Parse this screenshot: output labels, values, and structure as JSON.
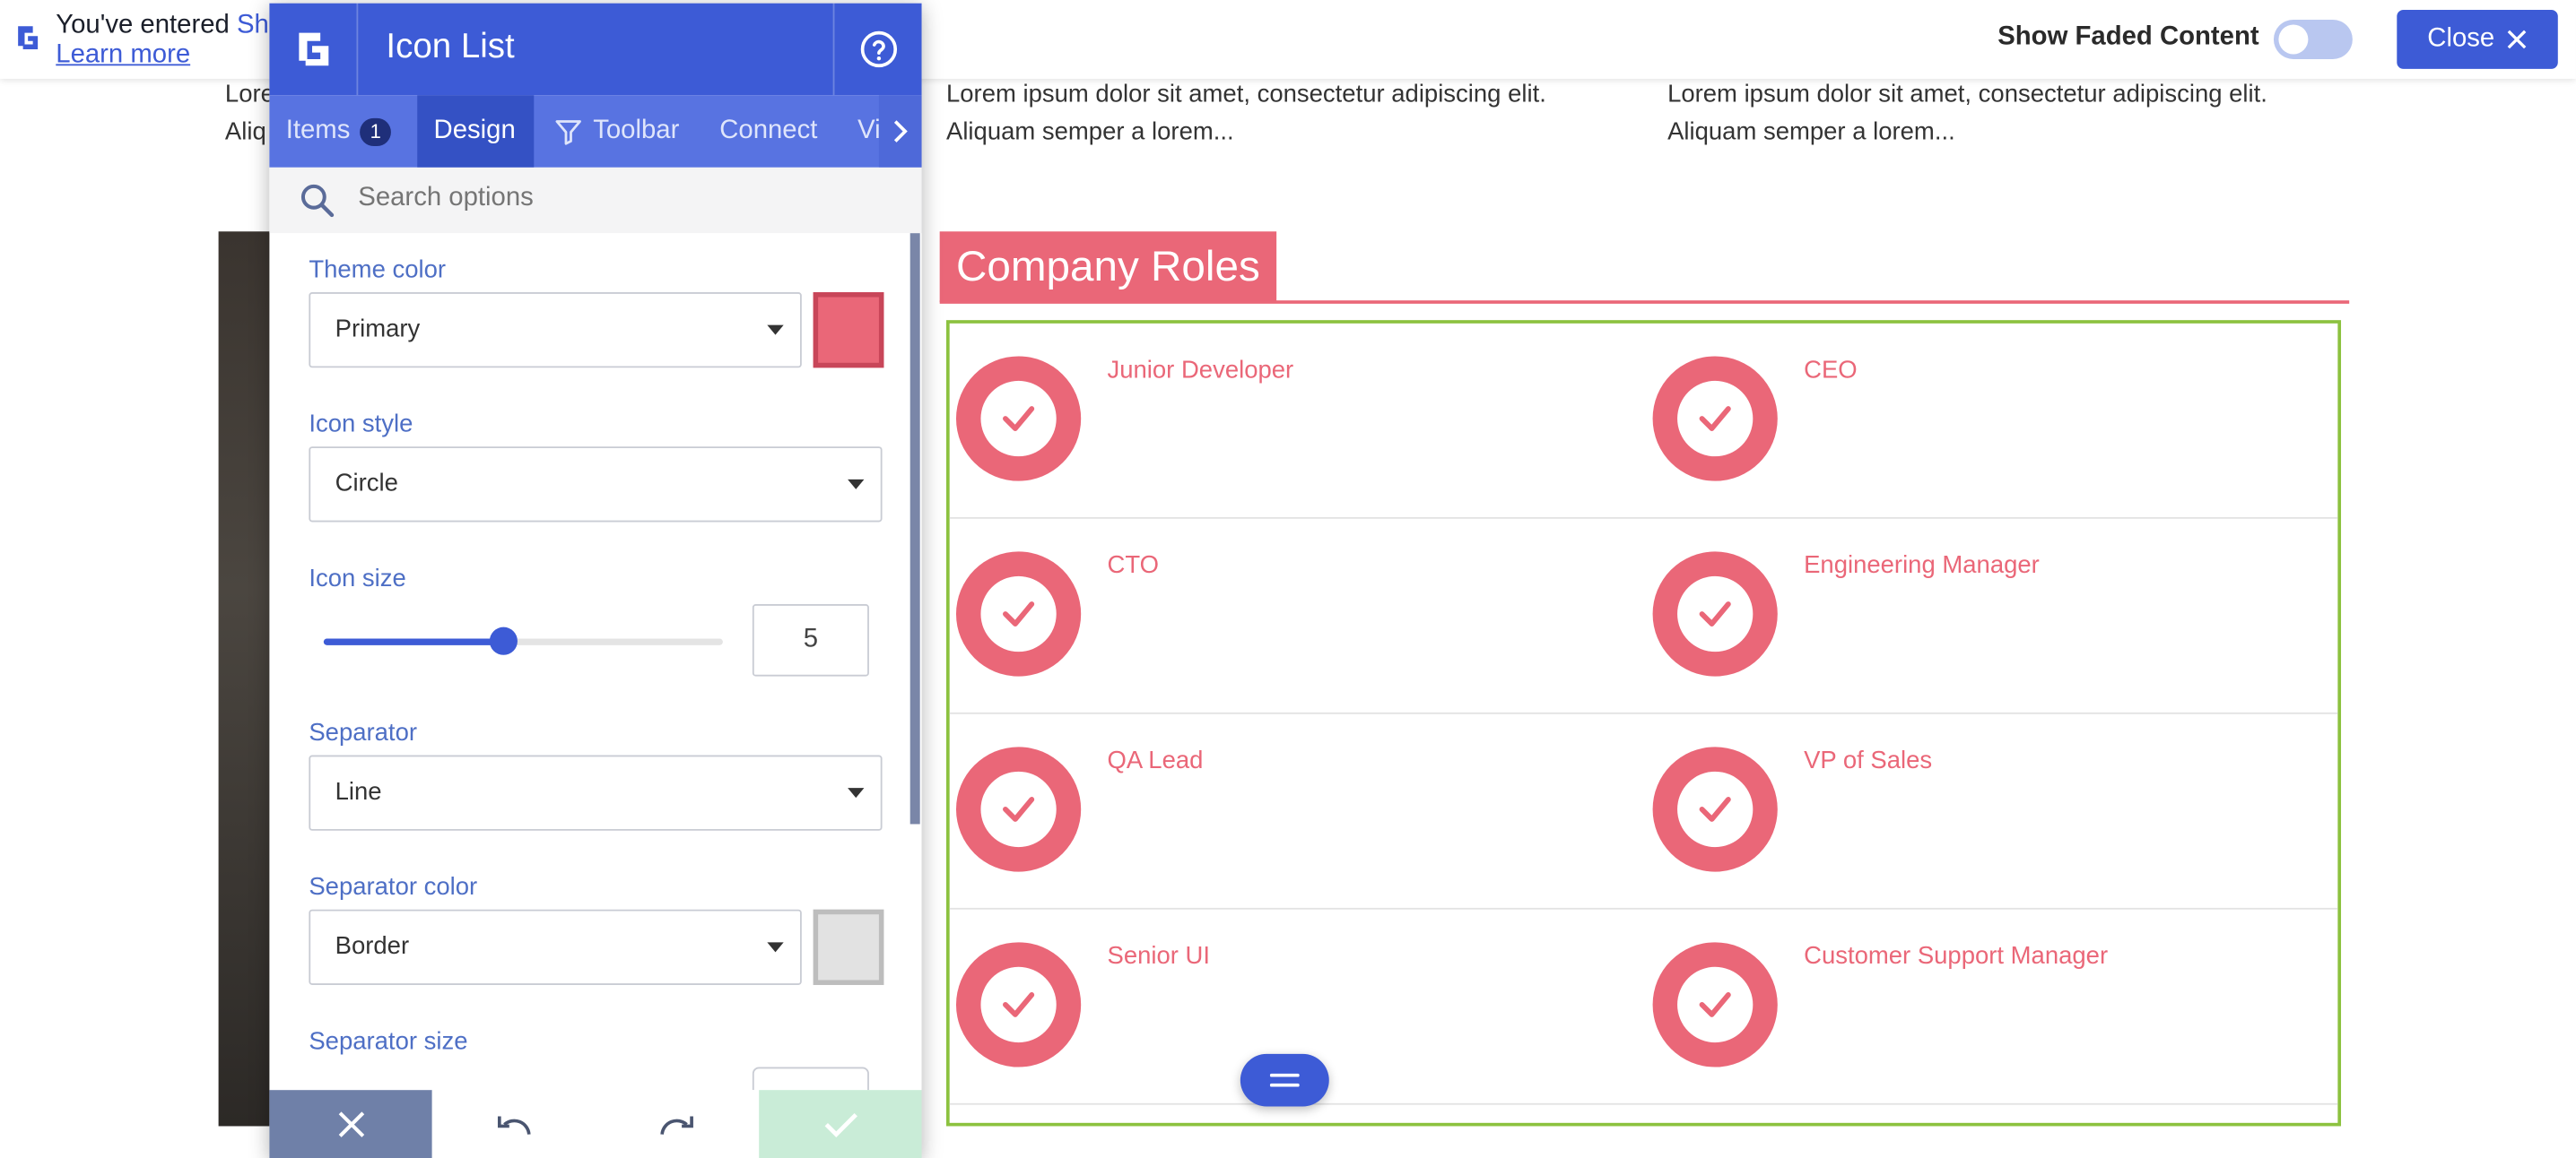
{
  "topbar": {
    "message_prefix": "You've entered ",
    "message_highlight": "Sh",
    "learn_more": "Learn more",
    "faded_label": "Show Faded Content",
    "faded_on": false,
    "close_label": "Close"
  },
  "page": {
    "left_snippet_line1": "Lore",
    "left_snippet_line2": "Aliq",
    "col2_line1": "Lorem ipsum dolor sit amet, consectetur adipiscing elit.",
    "col2_line2": "Aliquam semper a lorem...",
    "col3_line1": "Lorem ipsum dolor sit amet, consectetur adipiscing elit.",
    "col3_line2": "Aliquam semper a lorem...",
    "roles_heading": "Company Roles",
    "roles": [
      [
        "Junior Developer",
        "CEO"
      ],
      [
        "CTO",
        "Engineering Manager"
      ],
      [
        "QA Lead",
        "VP of Sales"
      ],
      [
        "Senior UI",
        "Customer Support Manager"
      ]
    ]
  },
  "panel": {
    "title": "Icon List",
    "tabs": [
      {
        "label": "Items",
        "badge": "1"
      },
      {
        "label": "Design"
      },
      {
        "label": "Toolbar"
      },
      {
        "label": "Connect"
      },
      {
        "label": "Vi"
      }
    ],
    "active_tab": "Design",
    "search_placeholder": "Search options",
    "fields": {
      "theme_color_label": "Theme color",
      "theme_color_value": "Primary",
      "icon_style_label": "Icon style",
      "icon_style_value": "Circle",
      "icon_size_label": "Icon size",
      "icon_size_value": "5",
      "icon_size_fraction": 0.45,
      "separator_label": "Separator",
      "separator_value": "Line",
      "separator_color_label": "Separator color",
      "separator_color_value": "Border",
      "separator_size_label": "Separator size"
    }
  },
  "colors": {
    "brand_blue": "#3d5bd6",
    "accent_pink": "#ea6778",
    "frame_green": "#8cc23f",
    "border_swatch": "#e2e2e2",
    "confirm_green": "#c9ecd7"
  }
}
